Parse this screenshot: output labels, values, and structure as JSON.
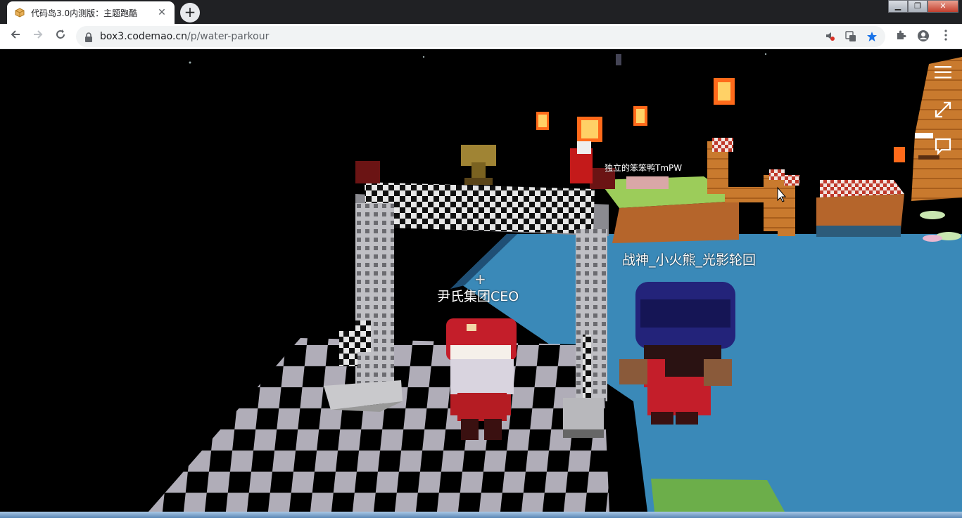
{
  "browser": {
    "tab_title": "代码岛3.0内测版：主题跑酷",
    "tab_close": "✕",
    "new_tab": "+",
    "url_host": "box3.codemao.cn",
    "url_path": "/p/water-parkour",
    "window_controls": [
      "▁",
      "❐",
      "✕"
    ]
  },
  "game": {
    "players": [
      {
        "name": "尹氏集团CEO"
      },
      {
        "name": "战神_小火熊_光影轮回"
      },
      {
        "name": "独立的笨笨鸭TmPW"
      }
    ],
    "crosshair": "+",
    "side_controls": [
      "menu-icon",
      "fullscreen-icon",
      "chat-icon"
    ],
    "colors": {
      "water": "#3a89b8",
      "checker_light": "#b0adb8",
      "checker_dark": "#000000",
      "gate": "#c9c9cc"
    }
  }
}
